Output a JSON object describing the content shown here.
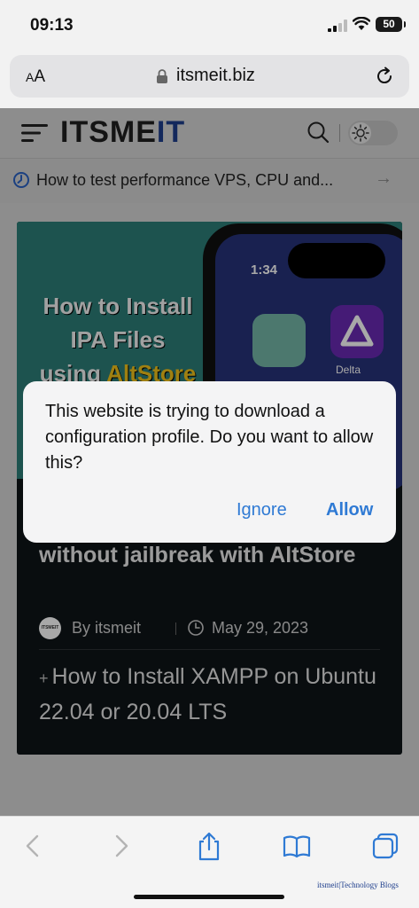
{
  "status": {
    "time": "09:13",
    "battery": "50"
  },
  "address_bar": {
    "text_size_label_small": "A",
    "text_size_label_large": "A",
    "url": "itsmeit.biz"
  },
  "site": {
    "logo_main": "ITSME",
    "logo_accent": "IT",
    "ticker_text": "How to test performance VPS, CPU and...",
    "ticker_arrow": "→"
  },
  "article": {
    "image_title_line1": "How to Install",
    "image_title_line2": "IPA Files",
    "image_title_line3_a": "using ",
    "image_title_line3_b": "AltStore",
    "image_phone_time": "1:34",
    "image_app_label": "Delta",
    "title": "without jailbreak with AltStore",
    "author_avatar": "ITSMEIT",
    "author": "By itsmeit",
    "date": "May 29, 2023",
    "related_plus": "+",
    "related_title": "How to Install XAMPP on Ubuntu 22.04 or 20.04 LTS"
  },
  "alert": {
    "message": "This website is trying to download a configuration profile. Do you want to allow this?",
    "ignore_label": "Ignore",
    "allow_label": "Allow",
    "accent_color": "#2f7ad4"
  },
  "watermark": "itsmeit|Technology Blogs"
}
